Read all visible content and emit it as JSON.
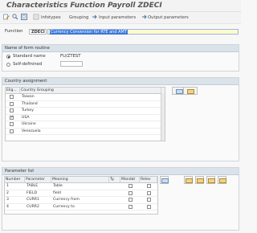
{
  "title": "Characteristics Function Payroll ZDECI",
  "toolbar": {
    "infotypes": "Infotypes",
    "grouping": "Grouping",
    "input_parameters": "Input parameters",
    "output_parameters": "Output parameters"
  },
  "function": {
    "label": "Function",
    "value": "ZDECI",
    "description_selected": "Currency Conversion for RTE and AMT"
  },
  "form_routine": {
    "header": "Name of form routine",
    "standard_label": "Standard name",
    "standard_value": "FU/ZTEST",
    "self_defined_label": "Self-definined",
    "self_defined_value": ""
  },
  "country_assignment": {
    "header": "Country assignment",
    "columns": [
      "Elig...",
      "Country Grouping"
    ],
    "rows": [
      {
        "checked": false,
        "country": "Taiwan"
      },
      {
        "checked": false,
        "country": "Thailand"
      },
      {
        "checked": false,
        "country": "Turkey"
      },
      {
        "checked": true,
        "country": "USA"
      },
      {
        "checked": false,
        "country": "Ukraine"
      },
      {
        "checked": false,
        "country": "Venezuela"
      }
    ]
  },
  "parameter_list": {
    "header": "Parameter list",
    "columns": [
      "Number",
      "Parameter",
      "Meaning",
      "Ty.",
      "Mandat",
      "Relev"
    ],
    "rows": [
      {
        "number": "1",
        "parameter": "TABLE",
        "meaning": "Table"
      },
      {
        "number": "2",
        "parameter": "FIELD",
        "meaning": "field"
      },
      {
        "number": "3",
        "parameter": "CURR1",
        "meaning": "Currency from"
      },
      {
        "number": "4",
        "parameter": "CURR2",
        "meaning": "Currency to"
      }
    ]
  },
  "colors": {
    "desc_bg": "#fff9cf",
    "selected": "#3b78d8",
    "group_header": "#dbe3ea"
  }
}
